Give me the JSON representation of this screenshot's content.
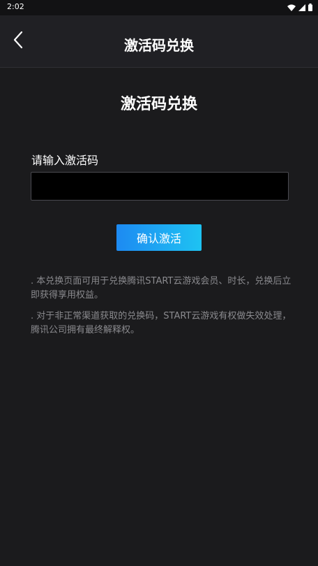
{
  "status_bar": {
    "time": "2:02"
  },
  "app_bar": {
    "title": "激活码兑换",
    "back_icon": "chevron-left-icon"
  },
  "main": {
    "page_title": "激活码兑换",
    "input_label": "请输入激活码",
    "input_value": "",
    "input_placeholder": "",
    "confirm_label": "确认激活",
    "notes": [
      ". 本兑换页面可用于兑换腾讯START云游戏会员、时长，兑换后立即获得享用权益。",
      ". 对于非正常渠道获取的兑换码，START云游戏有权做失效处理，腾讯公司拥有最终解释权。"
    ]
  },
  "colors": {
    "background": "#1b1b1d",
    "app_bar": "#202024",
    "accent_start": "#1d8af2",
    "accent_end": "#1ec3f2",
    "note_text": "#8a8a8e"
  }
}
